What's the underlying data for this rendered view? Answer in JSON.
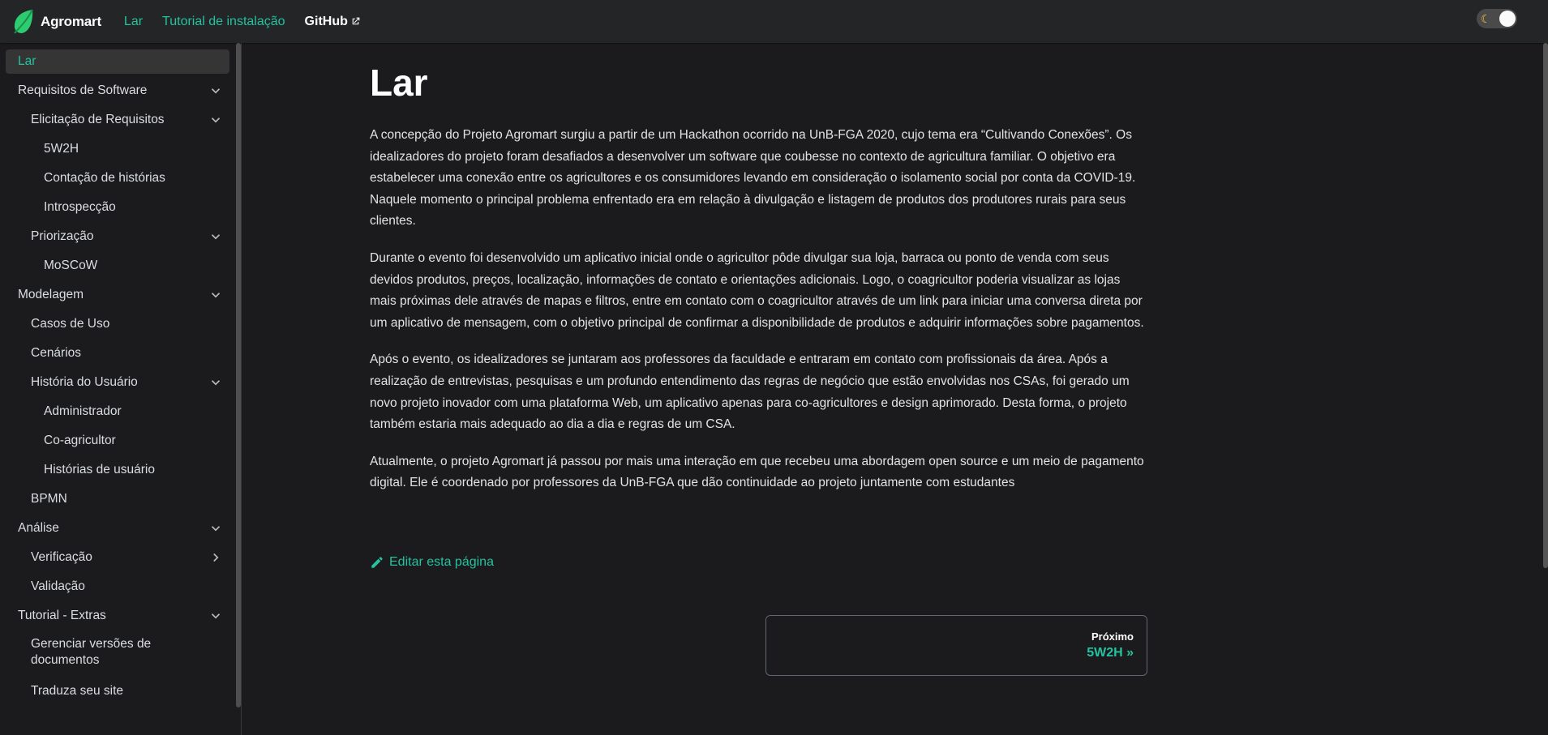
{
  "navbar": {
    "brand": "Agromart",
    "links": [
      "Lar",
      "Tutorial de instalação",
      "GitHub"
    ]
  },
  "sidebar": {
    "items": [
      "Lar",
      "Requisitos de Software",
      "Elicitação de Requisitos",
      "5W2H",
      "Contação de histórias",
      "Introspecção",
      "Priorização",
      "MoSCoW",
      "Modelagem",
      "Casos de Uso",
      "Cenários",
      "História do Usuário",
      "Administrador",
      "Co-agricultor",
      "Histórias de usuário",
      "BPMN",
      "Análise",
      "Verificação",
      "Validação",
      "Tutorial - Extras",
      "Gerenciar versões de documentos",
      "Traduza seu site"
    ]
  },
  "main": {
    "title": "Lar",
    "paragraphs": [
      "A concepção do Projeto Agromart surgiu a partir de um Hackathon ocorrido na UnB-FGA 2020, cujo tema era “Cultivando Conexões”. Os idealizadores do projeto foram desafiados a desenvolver um software que coubesse no contexto de agricultura familiar. O objetivo era estabelecer uma conexão entre os agricultores e os consumidores levando em consideração o isolamento social por conta da COVID-19. Naquele momento o principal problema enfrentado era em relação à divulgação e listagem de produtos dos produtores rurais para seus clientes.",
      "Durante o evento foi desenvolvido um aplicativo inicial onde o agricultor pôde divulgar sua loja, barraca ou ponto de venda com seus devidos produtos, preços, localização, informações de contato e orientações adicionais. Logo, o coagricultor poderia visualizar as lojas mais próximas dele através de mapas e filtros, entre em contato com o coagricultor através de um link para iniciar uma conversa direta por um aplicativo de mensagem, com o objetivo principal de confirmar a disponibilidade de produtos e adquirir informações sobre pagamentos.",
      "Após o evento, os idealizadores se juntaram aos professores da faculdade e entraram em contato com profissionais da área. Após a realização de entrevistas, pesquisas e um profundo entendimento das regras de negócio que estão envolvidas nos CSAs, foi gerado um novo projeto inovador com uma plataforma Web, um aplicativo apenas para co-agricultores e design aprimorado. Desta forma, o projeto também estaria mais adequado ao dia a dia e regras de um CSA.",
      "Atualmente, o projeto Agromart já passou por mais uma interação em que recebeu uma abordagem open source e um meio de pagamento digital. Ele é coordenado por professores da UnB-FGA que dão continuidade ao projeto juntamente com estudantes"
    ],
    "edit_label": "Editar esta página",
    "pager": {
      "sublabel": "Próximo",
      "label": "5W2H »"
    }
  },
  "colors": {
    "accent": "#25c2a0",
    "background": "#1b1b1d",
    "navbar": "#242526"
  }
}
